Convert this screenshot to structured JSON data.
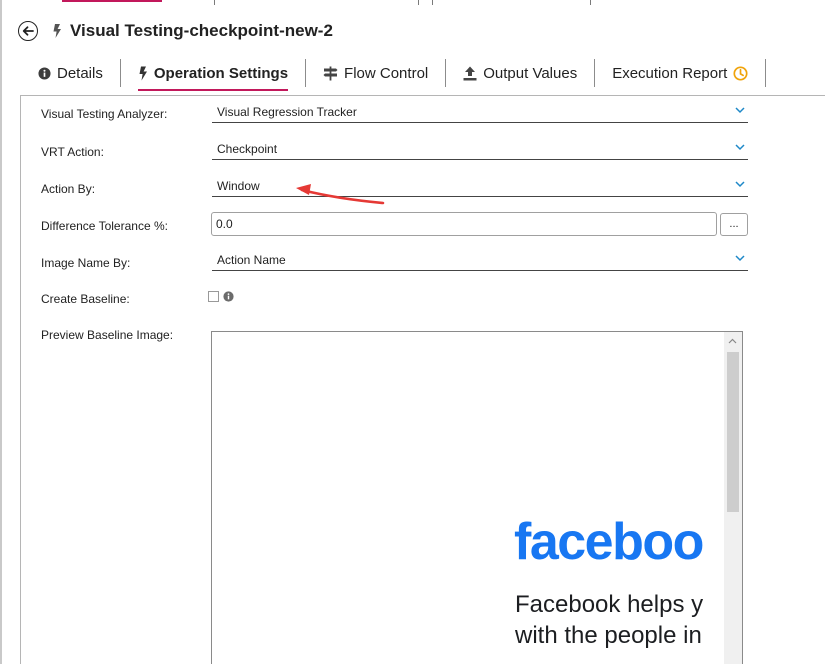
{
  "header": {
    "title": "Visual Testing-checkpoint-new-2"
  },
  "tabs": [
    {
      "label": "Details",
      "icon": "info-icon"
    },
    {
      "label": "Operation Settings",
      "icon": "lightning-icon",
      "active": true
    },
    {
      "label": "Flow Control",
      "icon": "signpost-icon"
    },
    {
      "label": "Output Values",
      "icon": "upload-icon"
    },
    {
      "label": "Execution Report",
      "icon": "clock-icon"
    }
  ],
  "form": {
    "analyzer": {
      "label": "Visual Testing Analyzer:",
      "value": "Visual Regression Tracker"
    },
    "vrt_action": {
      "label": "VRT Action:",
      "value": "Checkpoint"
    },
    "action_by": {
      "label": "Action By:",
      "value": "Window"
    },
    "tolerance": {
      "label": "Difference Tolerance %:",
      "value": "0.0",
      "button": "..."
    },
    "image_name_by": {
      "label": "Image Name By:",
      "value": "Action Name"
    },
    "create_baseline": {
      "label": "Create Baseline:",
      "checked": false
    },
    "preview": {
      "label": "Preview Baseline Image:",
      "logo_text": "faceboo",
      "line1": "Facebook helps y",
      "line2": "with the people in"
    }
  },
  "colors": {
    "accent_underline": "#c2185b",
    "facebook_blue": "#1877f2",
    "chevron_blue": "#1e88c8",
    "clock_orange": "#f0a30a",
    "annotation_red": "#e53935"
  }
}
